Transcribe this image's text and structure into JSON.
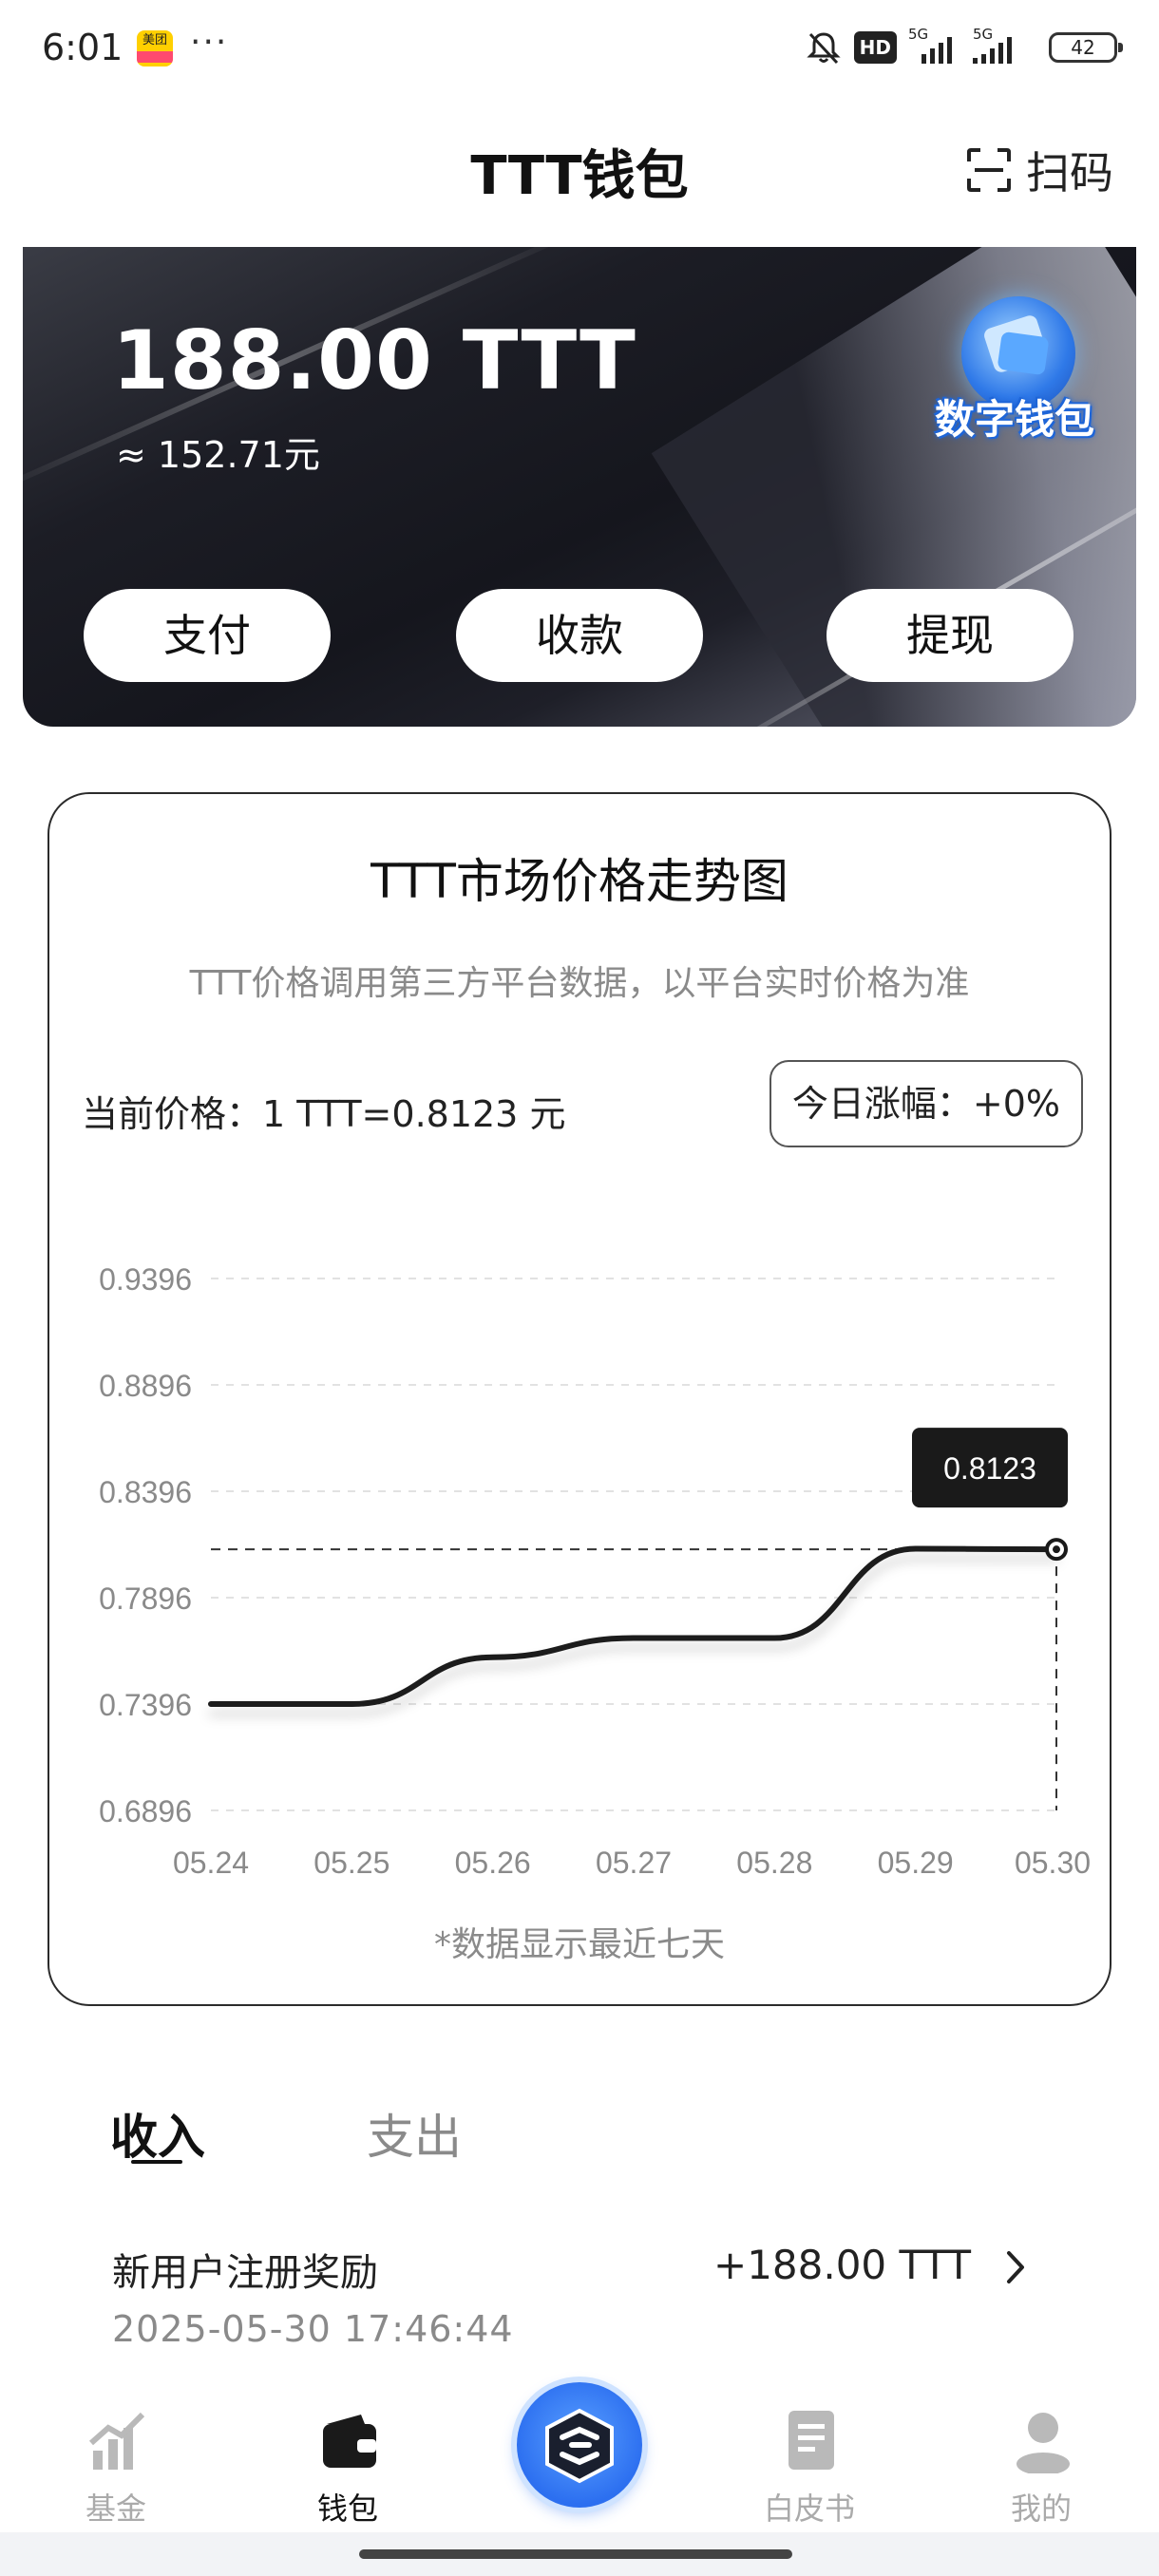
{
  "status_bar": {
    "time": "6:01",
    "app_badge": "美团",
    "app_badge_sub": "",
    "more": "···",
    "hd": "HD",
    "net1": "5G",
    "net2": "5G",
    "battery": "42"
  },
  "header": {
    "title": "TTT钱包",
    "scan_label": "扫码"
  },
  "wallet": {
    "balance": "188.00 TTT",
    "approx": "≈ 152.71元",
    "badge_text": "数字钱包",
    "buttons": [
      "支付",
      "收款",
      "提现"
    ]
  },
  "chart_card": {
    "title": "TTT市场价格走势图",
    "subtitle": "TTT价格调用第三方平台数据，以平台实时价格为准",
    "current_price": "当前价格：1 TTT=0.8123 元",
    "today_change": "今日涨幅：+0%",
    "note": "*数据显示最近七天",
    "tooltip": "0.8123"
  },
  "chart_data": {
    "type": "line",
    "title": "",
    "xlabel": "",
    "ylabel": "",
    "categories": [
      "05.24",
      "05.25",
      "05.26",
      "05.27",
      "05.28",
      "05.29",
      "05.30"
    ],
    "y_ticks": [
      "0.9396",
      "0.8896",
      "0.8396",
      "0.7896",
      "0.7396",
      "0.6896"
    ],
    "ylim": [
      0.6896,
      0.9396
    ],
    "series": [
      {
        "values": [
          0.7396,
          0.7396,
          0.7616,
          0.7706,
          0.7706,
          0.8126,
          0.8123
        ]
      }
    ],
    "reference_value": 0.8123,
    "grid": true,
    "colors": {
      "line": "#1a1a1a",
      "grid": "#e2e2e2",
      "tooltip_bg": "#1a1a1a"
    }
  },
  "tabs": [
    "收入",
    "支出"
  ],
  "records": [
    {
      "title": "新用户注册奖励",
      "amount": "+188.00 TTT",
      "time": "2025-05-30 17:46:44"
    }
  ],
  "bottom_nav": [
    {
      "label": "基金",
      "icon": "fund-chart-icon"
    },
    {
      "label": "钱包",
      "icon": "wallet-icon"
    },
    {
      "label": "",
      "icon": "brand-logo-icon"
    },
    {
      "label": "白皮书",
      "icon": "document-icon"
    },
    {
      "label": "我的",
      "icon": "user-icon"
    }
  ]
}
